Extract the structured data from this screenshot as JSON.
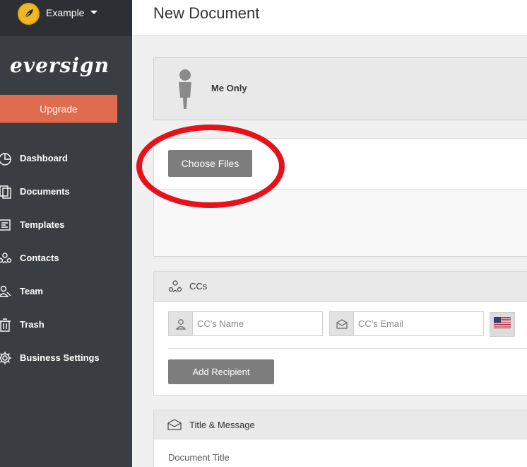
{
  "account": {
    "name": "Example",
    "logo_icon": "leaf-icon"
  },
  "brand": {
    "name": "eversign"
  },
  "upgrade_label": "Upgrade",
  "nav": {
    "items": [
      {
        "label": "Dashboard",
        "icon": "pie-chart-icon"
      },
      {
        "label": "Documents",
        "icon": "documents-icon"
      },
      {
        "label": "Templates",
        "icon": "templates-icon"
      },
      {
        "label": "Contacts",
        "icon": "contacts-icon"
      },
      {
        "label": "Team",
        "icon": "team-icon"
      },
      {
        "label": "Trash",
        "icon": "trash-icon"
      },
      {
        "label": "Business Settings",
        "icon": "gear-icon"
      }
    ]
  },
  "page": {
    "title": "New Document"
  },
  "signer_mode": {
    "label": "Me Only",
    "icon": "person-icon"
  },
  "upload": {
    "choose_label": "Choose Files"
  },
  "ccs": {
    "heading": "CCs",
    "name_placeholder": "CC's Name",
    "email_placeholder": "CC's Email",
    "add_label": "Add Recipient",
    "flag": "us-flag-icon"
  },
  "title_message": {
    "heading": "Title & Message",
    "doc_title_label": "Document Title"
  },
  "colors": {
    "sidebar": "#3a3d41",
    "upgrade": "#e06c4f",
    "button": "#7d7d7d",
    "highlight": "#e8111a",
    "account_logo": "#f2b824"
  }
}
